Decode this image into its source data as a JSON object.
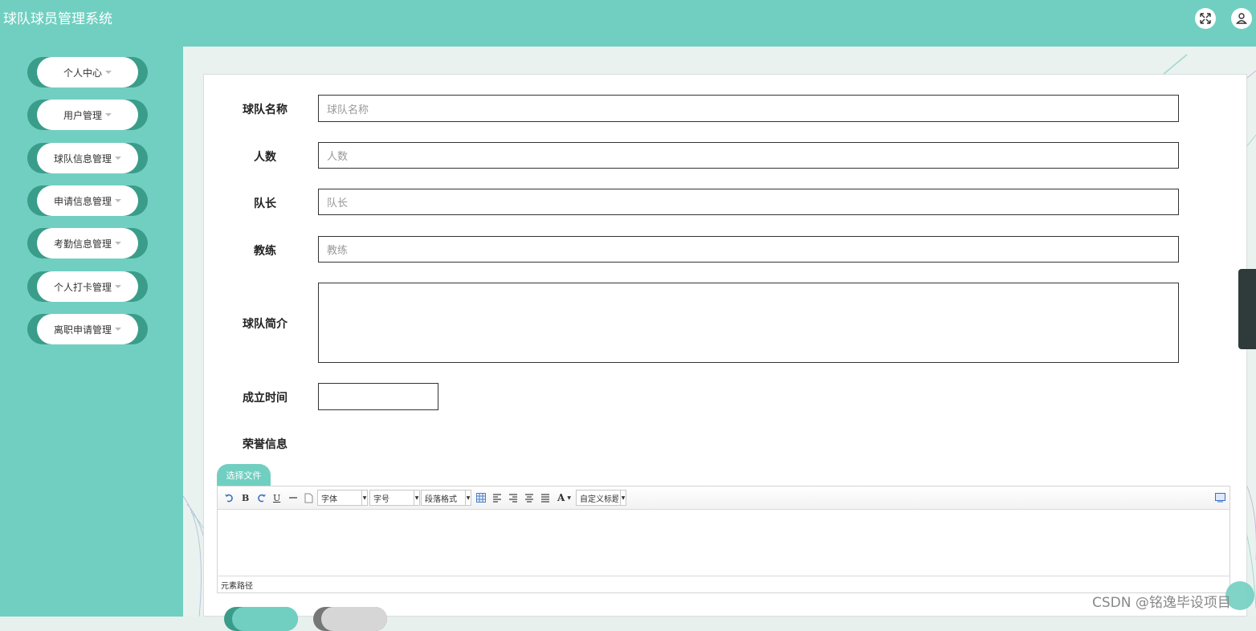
{
  "app": {
    "title": "球队球员管理系统"
  },
  "header": {
    "fullscreen_icon": "fullscreen-icon",
    "user_icon": "user-icon"
  },
  "sidebar": {
    "items": [
      {
        "label": "个人中心"
      },
      {
        "label": "用户管理"
      },
      {
        "label": "球队信息管理"
      },
      {
        "label": "申请信息管理"
      },
      {
        "label": "考勤信息管理"
      },
      {
        "label": "个人打卡管理"
      },
      {
        "label": "离职申请管理"
      }
    ]
  },
  "form": {
    "team_name": {
      "label": "球队名称",
      "placeholder": "球队名称"
    },
    "count": {
      "label": "人数",
      "placeholder": "人数"
    },
    "captain": {
      "label": "队长",
      "placeholder": "队长"
    },
    "coach": {
      "label": "教练",
      "placeholder": "教练"
    },
    "intro": {
      "label": "球队简介"
    },
    "founded": {
      "label": "成立时间"
    },
    "honors": {
      "label": "荣誉信息"
    },
    "upload_label": "选择文件"
  },
  "editor": {
    "font_family": "字体",
    "font_size": "字号",
    "paragraph": "段落格式",
    "custom_title": "自定义标题",
    "path_label": "元素路径",
    "bold": "B",
    "underline": "U",
    "font_color": "A"
  },
  "colors": {
    "primary": "#71cfc1",
    "primary_dark": "#3a9d8a"
  },
  "watermark": "CSDN @铭逸毕设项目"
}
